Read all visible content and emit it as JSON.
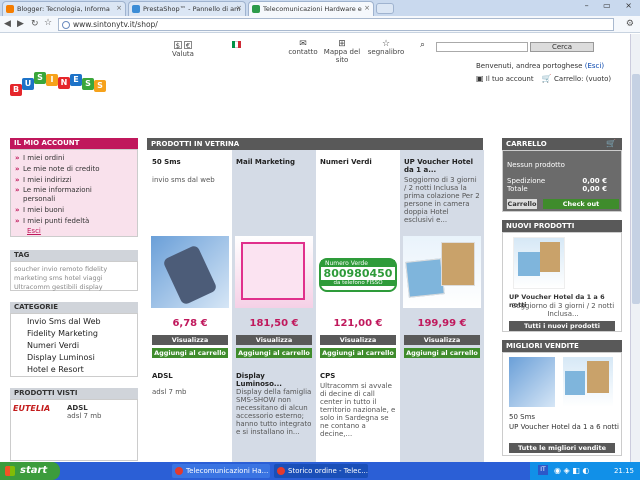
{
  "browser": {
    "tabs": [
      {
        "label": "Blogger: Tecnologia, Informa"
      },
      {
        "label": "PrestaShop™ - Pannello di am"
      },
      {
        "label": "Telecomunicazioni Hardware e"
      }
    ],
    "url": "www.sintonytv.it/shop/"
  },
  "header": {
    "currency_symbols": [
      "$",
      "€"
    ],
    "currency_label": "Valuta",
    "contact_label": "contatto",
    "sitemap_label": "Mappa del sito",
    "bookmark_label": "segnalibro",
    "search_button": "Cerca",
    "welcome": "Benvenuti, andrea portoghese",
    "logout": "(Esci)",
    "my_account": "Il tuo account",
    "cart_status": "Carrello: (vuoto)",
    "logo_letters": [
      "B",
      "U",
      "S",
      "I",
      "N",
      "E",
      "S",
      "S"
    ]
  },
  "account": {
    "title": "IL MIO ACCOUNT",
    "items": [
      "I miei ordini",
      "Le mie note di credito",
      "I miei indirizzi",
      "Le mie informazioni personali",
      "I miei buoni",
      "I miei punti fedeltà"
    ],
    "logout": "Esci"
  },
  "tags": {
    "title": "TAG",
    "text": "soucher invio remoto fidelity marketing sms hotel viaggi Ultracomm gestibili display"
  },
  "categories": {
    "title": "CATEGORIE",
    "items": [
      "Invio Sms dal Web",
      "Fidelity Marketing",
      "Numeri Verdi",
      "Display Luminosi",
      "Hotel e Resort"
    ]
  },
  "viewed": {
    "title": "PRODOTTI VISTI",
    "item_name": "ADSL",
    "item_desc": "adsl 7 mb",
    "logo_text": "EUTELIA"
  },
  "center": {
    "title": "PRODOTTI IN VETRINA",
    "view_label": "Visualizza",
    "add_label": "Aggiungi al carrello",
    "products": [
      {
        "name": "50 Sms",
        "desc": "invio sms dal web",
        "price": "6,78 €"
      },
      {
        "name": "Mail Marketing",
        "desc": "",
        "price": "181,50 €"
      },
      {
        "name": "Numeri Verdi",
        "desc": "",
        "price": "121,00 €",
        "img_text_top": "Numero Verde",
        "img_number": "800980450",
        "img_text_bottom": "da telefono FISSO"
      },
      {
        "name": "UP Voucher Hotel da 1 a...",
        "desc": "Soggiorno di 3 giorni / 2 notti Inclusa la prima colazione Per 2 persone in camera doppia Hotel esclusivi e...",
        "price": "199,99 €"
      }
    ],
    "second_row": [
      {
        "name": "ADSL",
        "desc": "adsl 7 mb"
      },
      {
        "name": "Display Luminoso...",
        "desc": "Display della famiglia SMS-SHOW non necessitano di alcun accessorio esterno; hanno tutto integrato e si installano in..."
      },
      {
        "name": "CPS",
        "desc": "Ultracomm si avvale di decine di call center in tutto il territorio nazionale, e solo in Sardegna se ne contano a decine,..."
      },
      {
        "name": "",
        "desc": ""
      }
    ]
  },
  "cart": {
    "title": "CARRELLO",
    "empty": "Nessun prodotto",
    "shipping_label": "Spedizione",
    "shipping_value": "0,00 €",
    "total_label": "Totale",
    "total_value": "0,00 €",
    "cart_button": "Carrello",
    "checkout_button": "Check out"
  },
  "new_products": {
    "title": "NUOVI PRODOTTI",
    "item": "UP Voucher Hotel da 1 a 6 notti",
    "item_desc": "Soggiorno di 3 giorni / 2 notti Inclusa...",
    "all_button": "Tutti i nuovi prodotti"
  },
  "best_sellers": {
    "title": "MIGLIORI VENDITE",
    "items": [
      "50 Sms",
      "UP Voucher Hotel da 1 a 6 notti"
    ],
    "all_button": "Tutte le migliori vendite"
  },
  "taskbar": {
    "start": "start",
    "items": [
      "Telecomunicazioni Ha...",
      "Storico ordine - Telec..."
    ],
    "lang": "IT",
    "clock": "21.15"
  }
}
